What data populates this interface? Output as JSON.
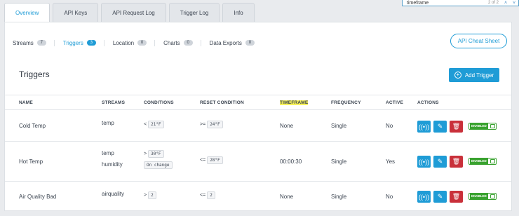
{
  "tabs": [
    "Overview",
    "API Keys",
    "API Request Log",
    "Trigger Log",
    "Info"
  ],
  "find": {
    "query": "timeframe",
    "count": "2 of 2"
  },
  "subnav": [
    {
      "label": "Streams",
      "count": "7"
    },
    {
      "label": "Triggers",
      "count": "3"
    },
    {
      "label": "Location",
      "count": "0"
    },
    {
      "label": "Charts",
      "count": "0"
    },
    {
      "label": "Data Exports",
      "count": "0"
    }
  ],
  "cheat_sheet_label": "API Cheat Sheet",
  "section_title": "Triggers",
  "add_trigger_label": "Add Trigger",
  "columns": [
    "NAME",
    "STREAMS",
    "CONDITIONS",
    "RESET CONDITION",
    "TIMEFRAME",
    "FREQUENCY",
    "ACTIVE",
    "ACTIONS"
  ],
  "rows": [
    {
      "name": "Cold Temp",
      "streams": [
        "temp"
      ],
      "cond_op": "<",
      "cond_val": "21°F",
      "reset_op": ">=",
      "reset_val": "24°F",
      "timeframe": "None",
      "frequency": "Single",
      "active": "No",
      "status": "ENABLED"
    },
    {
      "name": "Hot Temp",
      "streams": [
        "temp",
        "humidity"
      ],
      "cond_op": ">",
      "cond_val": "30°F",
      "cond_extra": "On change",
      "reset_op": "<=",
      "reset_val": "28°F",
      "timeframe": "00:00:30",
      "frequency": "Single",
      "active": "Yes",
      "status": "ENABLED"
    },
    {
      "name": "Air Quality Bad",
      "streams": [
        "airquality"
      ],
      "cond_op": ">",
      "cond_val": "2",
      "reset_op": "<=",
      "reset_val": "2",
      "timeframe": "None",
      "frequency": "Single",
      "active": "No",
      "status": "ENABLED"
    }
  ],
  "colors": {
    "accent": "#1f9cd6",
    "delete": "#c9303a",
    "enabled": "#39a22f",
    "highlight": "#f7f25a"
  }
}
